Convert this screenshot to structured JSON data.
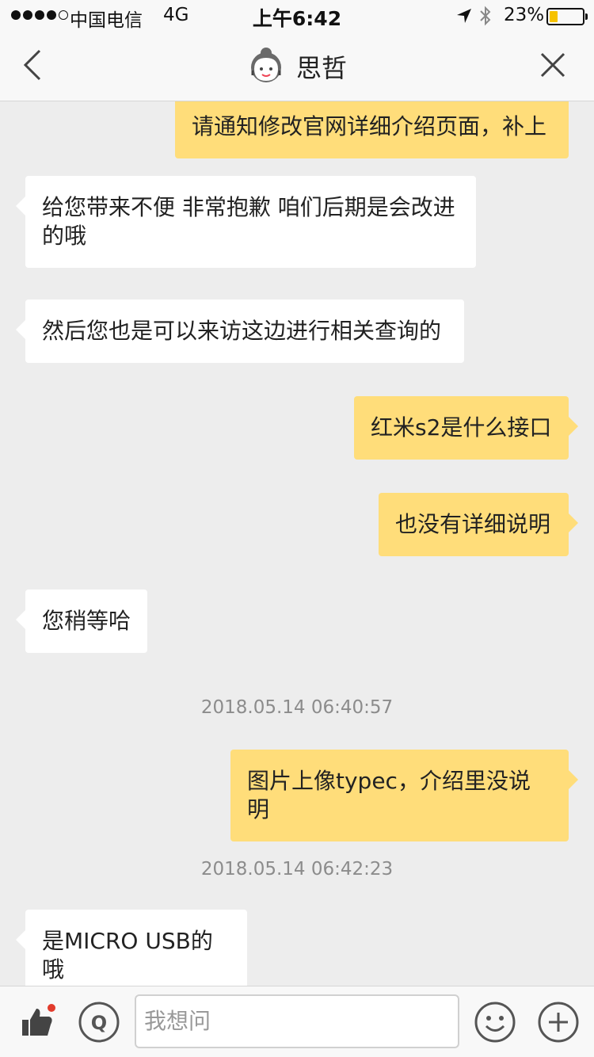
{
  "status_bar": {
    "carrier": "中国电信",
    "network": "4G",
    "time": "上午6:42",
    "battery_percent": "23%",
    "battery_level": 0.23,
    "battery_color": "#f6c200"
  },
  "nav": {
    "title": "思哲",
    "back_icon": "chevron-left-icon",
    "close_icon": "close-icon",
    "avatar_icon": "support-agent-icon"
  },
  "messages": [
    {
      "side": "out",
      "text": "请通知修改官网详细介绍页面，补上"
    },
    {
      "side": "in",
      "text": "给您带来不便 非常抱歉 咱们后期是会改进的哦"
    },
    {
      "side": "in",
      "text": "然后您也是可以来访这边进行相关查询的"
    },
    {
      "side": "out",
      "text": "红米s2是什么接口"
    },
    {
      "side": "out",
      "text": "也没有详细说明"
    },
    {
      "side": "in",
      "text": "您稍等哈"
    },
    {
      "side": "stamp",
      "text": "2018.05.14 06:40:57"
    },
    {
      "side": "out",
      "text": "图片上像typec，介绍里没说明"
    },
    {
      "side": "stamp",
      "text": "2018.05.14 06:42:23"
    },
    {
      "side": "in",
      "text": "是MICRO USB的哦"
    }
  ],
  "input": {
    "placeholder": "我想问"
  },
  "colors": {
    "outgoing_bubble": "#ffdd7a",
    "incoming_bubble": "#ffffff",
    "background": "#ededed",
    "badge": "#e23b2c"
  }
}
